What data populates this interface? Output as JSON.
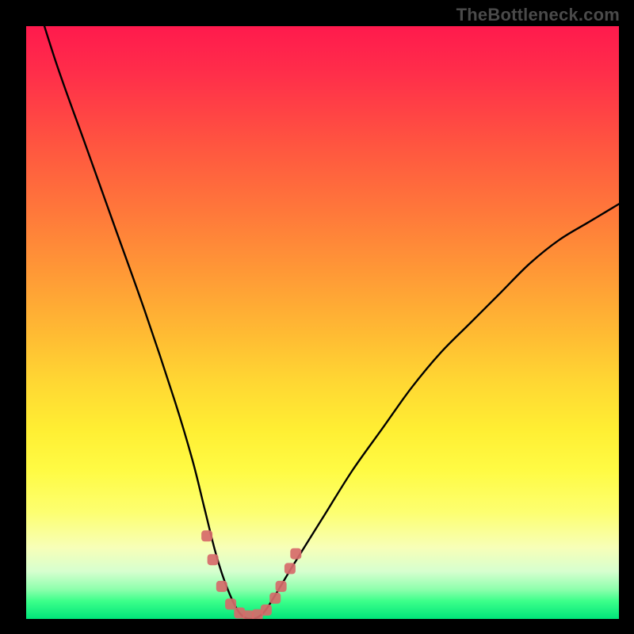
{
  "watermark": {
    "text": "TheBottleneck.com"
  },
  "colors": {
    "frame": "#000000",
    "curve": "#000000",
    "markers": "#d66a6a",
    "gradient_top": "#ff1a4d",
    "gradient_bottom": "#00e57a"
  },
  "chart_data": {
    "type": "line",
    "title": "",
    "xlabel": "",
    "ylabel": "",
    "xlim": [
      0,
      100
    ],
    "ylim": [
      0,
      100
    ],
    "grid": false,
    "legend": false,
    "annotations": [],
    "series": [
      {
        "name": "bottleneck-curve",
        "x": [
          0,
          5,
          10,
          15,
          20,
          25,
          28,
          30,
          32,
          34,
          36,
          38,
          40,
          42,
          45,
          50,
          55,
          60,
          65,
          70,
          75,
          80,
          85,
          90,
          95,
          100
        ],
        "y": [
          110,
          94,
          80,
          66,
          52,
          37,
          27,
          19,
          11,
          5,
          1,
          0,
          1,
          4,
          9,
          17,
          25,
          32,
          39,
          45,
          50,
          55,
          60,
          64,
          67,
          70
        ]
      }
    ],
    "markers": [
      {
        "x": 30.5,
        "y": 14
      },
      {
        "x": 31.5,
        "y": 10
      },
      {
        "x": 33.0,
        "y": 5.5
      },
      {
        "x": 34.5,
        "y": 2.5
      },
      {
        "x": 36.0,
        "y": 1.0
      },
      {
        "x": 37.5,
        "y": 0.5
      },
      {
        "x": 39.0,
        "y": 0.7
      },
      {
        "x": 40.5,
        "y": 1.5
      },
      {
        "x": 42.0,
        "y": 3.5
      },
      {
        "x": 43.0,
        "y": 5.5
      },
      {
        "x": 44.5,
        "y": 8.5
      },
      {
        "x": 45.5,
        "y": 11.0
      }
    ]
  }
}
